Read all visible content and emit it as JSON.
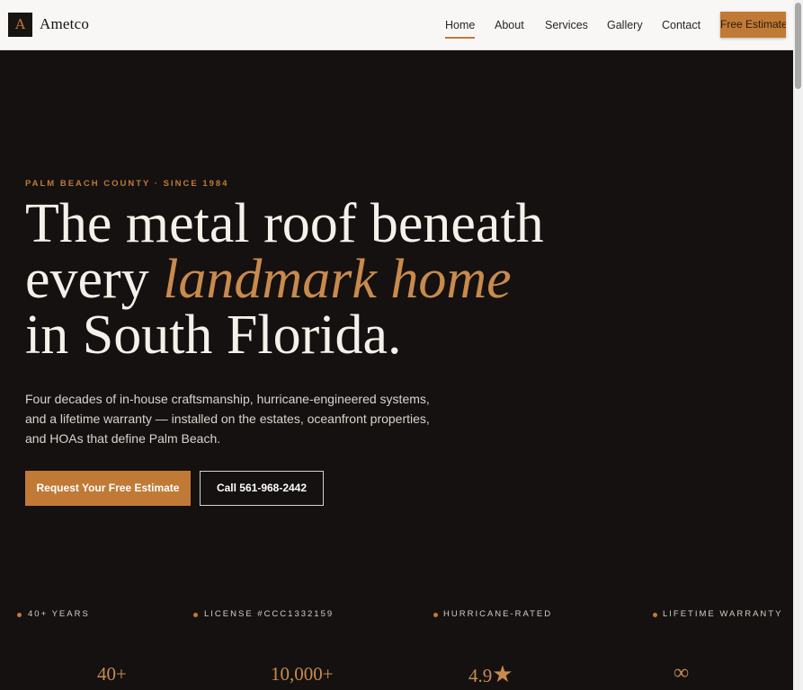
{
  "header": {
    "logo_mark": "A",
    "brand": "Ametco",
    "nav": [
      {
        "label": "Home",
        "active": true
      },
      {
        "label": "About",
        "active": false
      },
      {
        "label": "Services",
        "active": false
      },
      {
        "label": "Gallery",
        "active": false
      },
      {
        "label": "Contact",
        "active": false
      }
    ],
    "cta": "Free Estimate"
  },
  "hero": {
    "eyebrow": "PALM BEACH COUNTY · SINCE 1984",
    "headline_part1": "The metal roof beneath every",
    "headline_accent": "landmark home",
    "headline_part2": "in South Florida.",
    "lede": "Four decades of in-house craftsmanship, hurricane-engineered systems, and a lifetime warranty — installed on the estates, oceanfront properties, and HOAs that define Palm Beach.",
    "primary_button": "Request Your Free Estimate",
    "secondary_button": "Call 561-968-2442"
  },
  "stats": [
    {
      "label": "40+ YEARS",
      "value": "40+"
    },
    {
      "label": "LICENSE #CCC1332159",
      "value": "10,000+"
    },
    {
      "label": "HURRICANE-RATED",
      "value": "4.9",
      "icon": "star-icon"
    },
    {
      "label": "LIFETIME WARRANTY",
      "value": "∞"
    }
  ],
  "colors": {
    "accent": "#c17a36",
    "background": "#141110",
    "header_bg": "#f8f7f5"
  }
}
